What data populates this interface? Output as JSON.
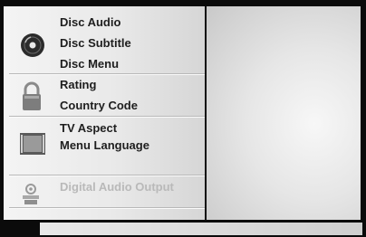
{
  "menu": {
    "groups": [
      {
        "name": "disc",
        "icon": "disc-icon",
        "items": [
          "Disc Audio",
          "Disc Subtitle",
          "Disc Menu"
        ]
      },
      {
        "name": "lock",
        "icon": "lock-icon",
        "items": [
          "Rating",
          "Country Code"
        ]
      },
      {
        "name": "tv",
        "icon": "tv-icon",
        "items": [
          "TV Aspect",
          "Menu Language"
        ]
      },
      {
        "name": "audio",
        "icon": "speaker-icon",
        "items": [
          "Digital Audio Output"
        ]
      }
    ]
  },
  "colors": {
    "background": "#0b0b0b",
    "panel": "#eeeeee",
    "text": "#1e1e1e",
    "disabled_text": "#b9b9b9"
  }
}
